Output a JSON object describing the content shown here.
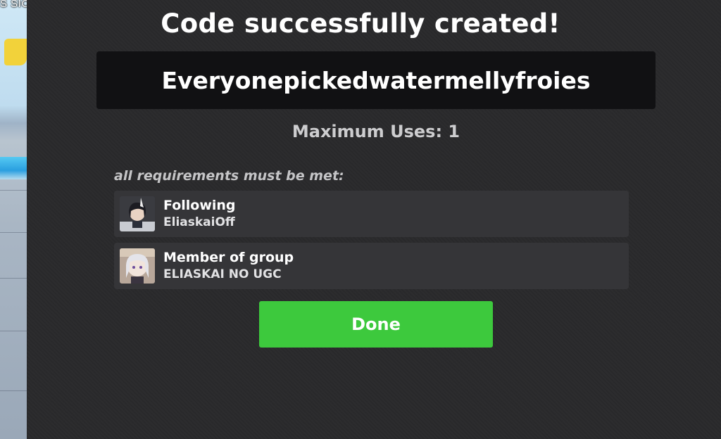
{
  "background": {
    "corner_text": "S SICK"
  },
  "dialog": {
    "title": "Code successfully created!",
    "code": "Everyonepickedwatermellyfroies",
    "max_uses": "Maximum Uses: 1",
    "requirements_heading": "all requirements must be met:",
    "requirements": [
      {
        "label": "Following",
        "value": "EliaskaiOff",
        "icon": "user-avatar"
      },
      {
        "label": "Member of group",
        "value": "ELIASKAI NO UGC",
        "icon": "group-avatar"
      }
    ],
    "done_label": "Done"
  },
  "colors": {
    "panel": "#2a2a2c",
    "code_box": "#111113",
    "row": "#353538",
    "done": "#3dc93d"
  }
}
